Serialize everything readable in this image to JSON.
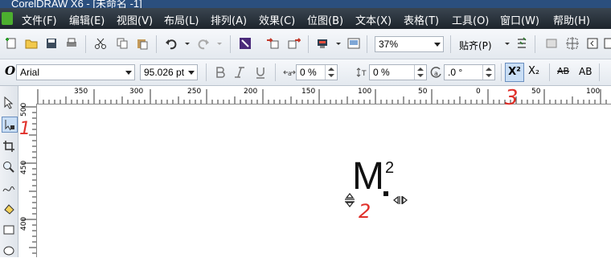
{
  "window": {
    "title": "CorelDRAW X6 - [未命名 -1]"
  },
  "menu": [
    "文件(F)",
    "编辑(E)",
    "视图(V)",
    "布局(L)",
    "排列(A)",
    "效果(C)",
    "位图(B)",
    "文本(X)",
    "表格(T)",
    "工具(O)",
    "窗口(W)",
    "帮助(H)"
  ],
  "standard_toolbar": {
    "zoom_value": "37%",
    "snap_label": "贴齐(P)"
  },
  "text_toolbar": {
    "font_name": "Arial",
    "font_size": "95.026 pt",
    "char_spacing": "0 %",
    "baseline_shift": "0 %",
    "rotation": ".0 °",
    "superscript_label": "X²",
    "subscript_label": "X₂",
    "small_caps_label": "AB",
    "all_caps_label": "AB"
  },
  "ruler": {
    "h_labels": [
      "350",
      "300",
      "250",
      "200",
      "150",
      "100",
      "50",
      "0",
      "50",
      "100"
    ],
    "v_labels": [
      "500",
      "450",
      "400"
    ]
  },
  "canvas_text": {
    "main": "M",
    "superscript": "2"
  },
  "annotations": [
    "1",
    "2",
    "3"
  ],
  "colors": {
    "annotation": "#e0302a",
    "menubar": "#2a333d",
    "active_button": "#c9def5"
  }
}
